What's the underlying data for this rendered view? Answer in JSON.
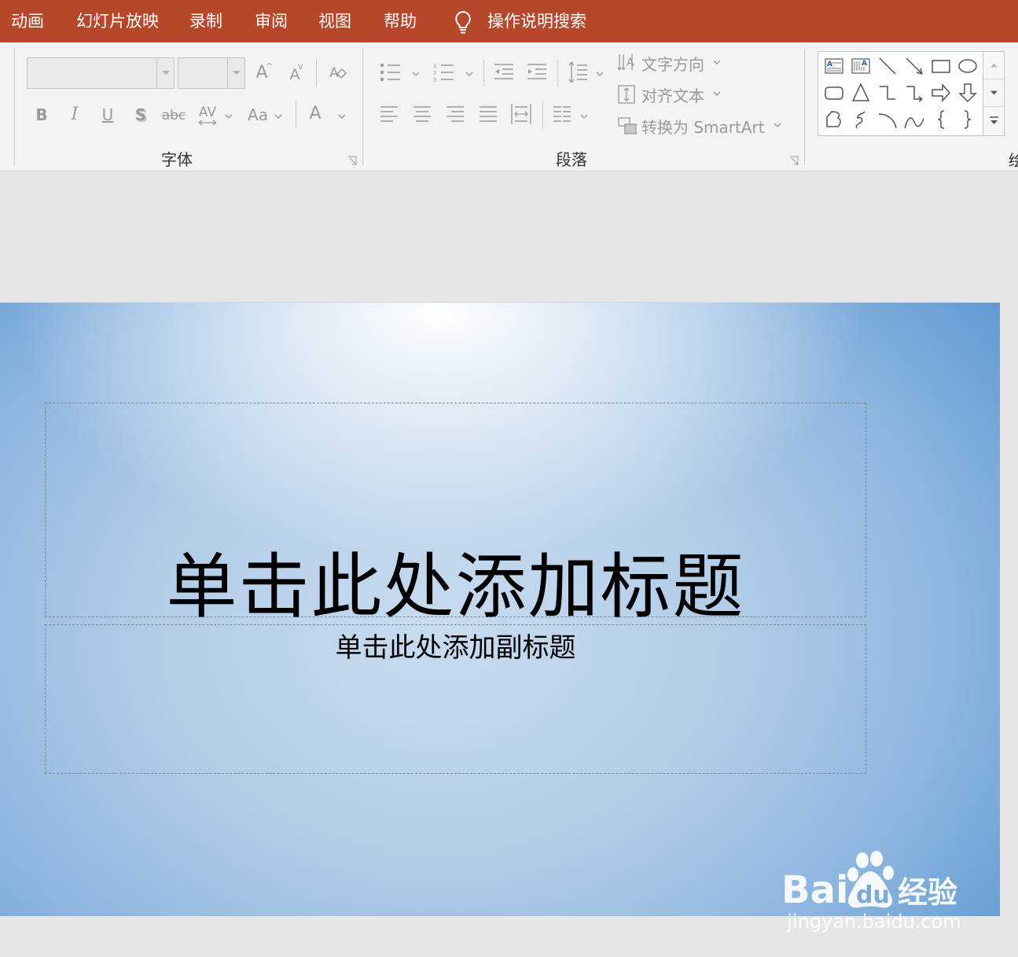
{
  "tabs": [
    "动画",
    "幻灯片放映",
    "录制",
    "审阅",
    "视图",
    "帮助"
  ],
  "tell_me": "操作说明搜索",
  "ribbon": {
    "font_group": {
      "label": "字体",
      "font_name_value": "",
      "font_size_value": "",
      "buttons": {
        "grow": "A",
        "shrink": "A",
        "bold": "B",
        "italic": "I",
        "underline": "U",
        "shadow": "S",
        "strike": "abc",
        "spacing": "AV",
        "case": "Aa",
        "color": "A"
      }
    },
    "paragraph_group": {
      "label": "段落",
      "text_direction": "文字方向",
      "align_text": "对齐文本",
      "convert_smartart": "转换为 SmartArt"
    },
    "next_group_partial": "绘"
  },
  "slide": {
    "title_placeholder": "单击此处添加标题",
    "subtitle_placeholder": "单击此处添加副标题"
  },
  "watermark": {
    "brand": "Baidu经验",
    "url": "jingyan.baidu.com"
  },
  "colors": {
    "tab_bar": "#b7472a",
    "ribbon_bg": "#f3f3f3",
    "workspace_bg": "#e6e6e6",
    "slide_edge": "#5f9ad3"
  }
}
